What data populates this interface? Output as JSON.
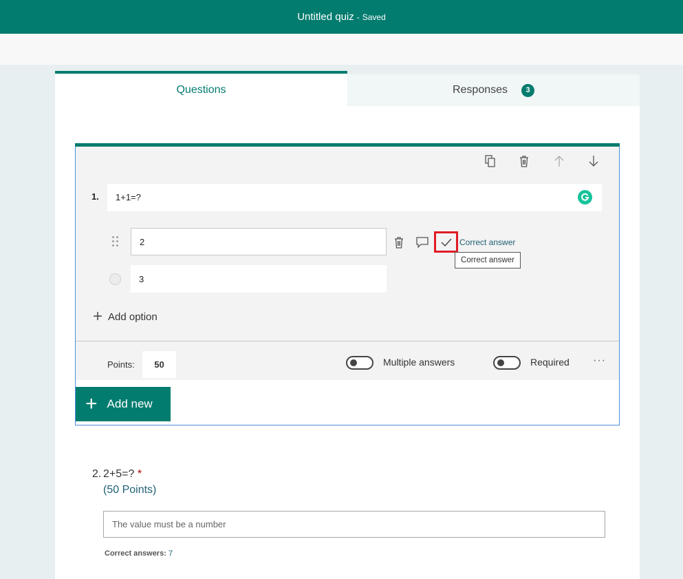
{
  "header": {
    "title": "Untitled quiz",
    "separator": "-",
    "status": "Saved"
  },
  "tabs": [
    {
      "label": "Questions"
    },
    {
      "label": "Responses",
      "badge": "3"
    }
  ],
  "question1": {
    "number": "1.",
    "text": "1+1=?",
    "options": [
      {
        "value": "2"
      },
      {
        "value": "3"
      }
    ],
    "correct_answer_label": "Correct answer",
    "tooltip": "Correct answer",
    "add_option_label": "Add option",
    "points_label": "Points:",
    "points_value": "50",
    "multiple_answers_label": "Multiple answers",
    "multiple_answers_on": false,
    "required_label": "Required",
    "required_on": false,
    "more_label": "···"
  },
  "add_new_label": "Add new",
  "question2": {
    "number": "2.",
    "text": "2+5=?",
    "required_marker": "*",
    "points_text": "(50 Points)",
    "placeholder": "The value must be a number",
    "correct_answers_label": "Correct answers:",
    "correct_answers_value": "7"
  },
  "colors": {
    "brand": "#027c6e",
    "highlight": "#e01b24",
    "selection_border": "#4f8edb"
  },
  "icons": [
    "copy-icon",
    "trash-icon",
    "arrow-up-icon",
    "arrow-down-icon",
    "grammarly-icon",
    "drag-handle-icon",
    "comment-icon",
    "checkmark-icon",
    "plus-icon"
  ]
}
